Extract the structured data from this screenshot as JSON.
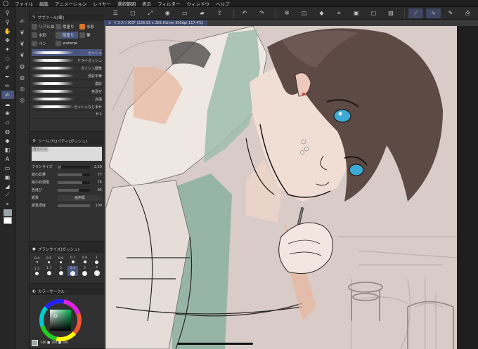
{
  "menubar": {
    "items": [
      "ファイル",
      "編集",
      "アニメーション",
      "レイヤー",
      "選択範囲",
      "表示",
      "フィルター",
      "ウィンドウ",
      "ヘルプ"
    ]
  },
  "subtool_panel": {
    "title": "サブツール[筆]",
    "tabs": [
      {
        "label": "リアル油"
      },
      {
        "label": "厚塗り"
      },
      {
        "label": "水彩"
      },
      {
        "label": "水彩"
      },
      {
        "label": "厚塗り"
      },
      {
        "label": "筆"
      },
      {
        "label": "ペン"
      },
      {
        "label": "waterpr"
      }
    ],
    "brushes": [
      {
        "label": "ガッシュ"
      },
      {
        "label": "ドライガッシュ"
      },
      {
        "label": "ガッシュ細筆"
      },
      {
        "label": "流彩平筆"
      },
      {
        "label": "濃彩"
      },
      {
        "label": "色混ぜ"
      },
      {
        "label": "点描"
      },
      {
        "label": "ガッシュなじませ"
      },
      {
        "label": "H 1"
      }
    ]
  },
  "tool_property": {
    "title": "ツールプロパティ[ガッシュ]",
    "brush_name": "ガッシュ",
    "rows": [
      {
        "name": "ブラシサイズ",
        "value": "2.50",
        "fill": 0.1
      },
      {
        "name": "絵の具量",
        "value": "77",
        "fill": 0.77
      },
      {
        "name": "絵の具濃度",
        "value": "76",
        "fill": 0.76
      },
      {
        "name": "色延び",
        "value": "65",
        "fill": 0.65
      },
      {
        "name": "紙質",
        "value": "画用紙",
        "fill": 0
      },
      {
        "name": "紙質濃度",
        "value": "100",
        "fill": 1.0
      }
    ]
  },
  "brush_size_panel": {
    "title": "ブラシサイズ[ガッシュ]",
    "sizes": [
      "0.4",
      "0.5",
      "0.6",
      "0.7",
      "0.8",
      "1",
      "1.5",
      "1.7",
      "2",
      "2.5",
      "3",
      "4"
    ],
    "selected": "2.5"
  },
  "color_panel": {
    "title": "カラーサークル",
    "values": "146 ■ 160 ■ 160"
  },
  "document": {
    "tab": "イラスト303* (226.93 x 283.61mm 350dpi 117.4%)"
  },
  "colors": {
    "accent": "#4a5580",
    "canvas_bg": "#d9ccc8",
    "hair": "#5d4a45",
    "skin": "#f0ddd4",
    "eye": "#3fa9d6",
    "mint": "#9dbdae",
    "peach": "#e8b79d"
  }
}
